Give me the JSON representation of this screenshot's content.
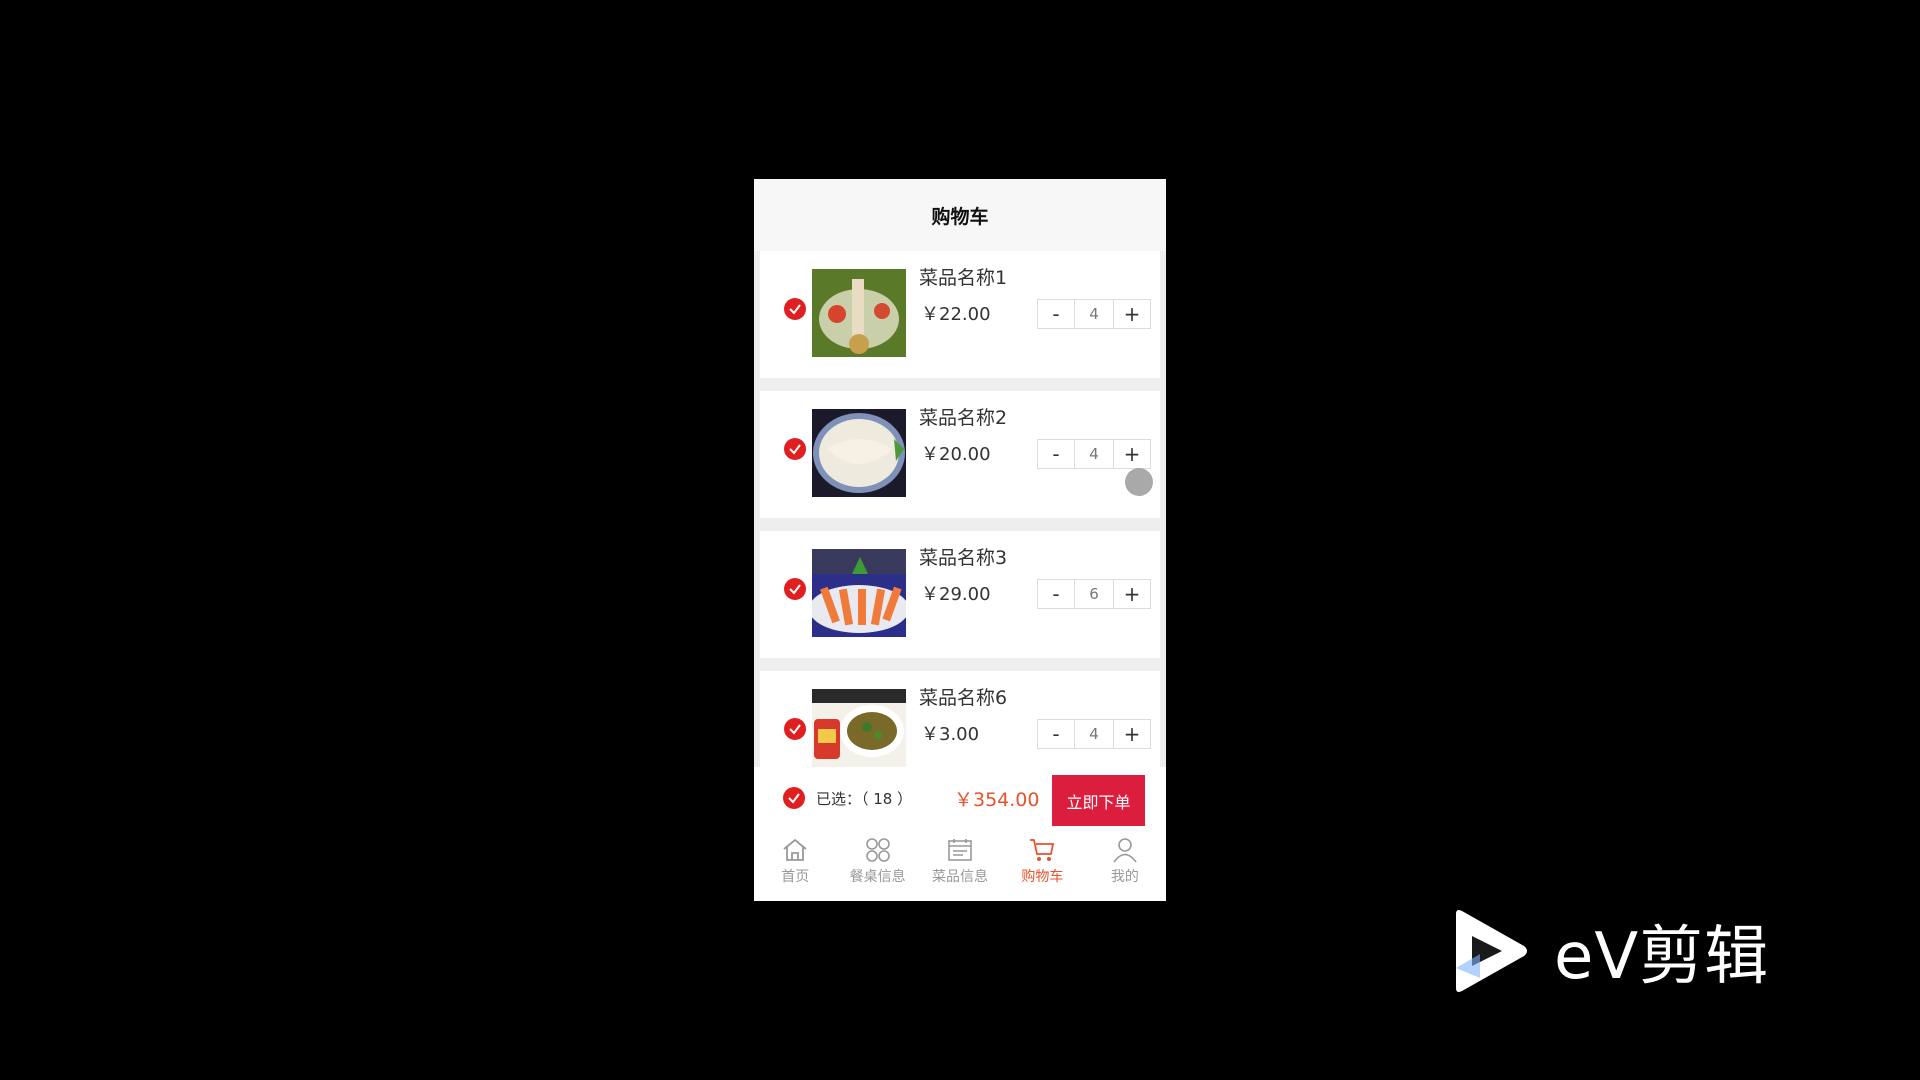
{
  "header": {
    "title": "购物车"
  },
  "cart_items": [
    {
      "name": "菜品名称1",
      "price": "￥22.00",
      "qty": "4",
      "selected": true
    },
    {
      "name": "菜品名称2",
      "price": "￥20.00",
      "qty": "4",
      "selected": true
    },
    {
      "name": "菜品名称3",
      "price": "￥29.00",
      "qty": "6",
      "selected": true
    },
    {
      "name": "菜品名称6",
      "price": "￥3.00",
      "qty": "4",
      "selected": true
    }
  ],
  "stepper": {
    "minus": "-",
    "plus": "+"
  },
  "footer": {
    "selected_label": "已选：（ 18 ）",
    "total": "￥354.00",
    "order_button": "立即下单"
  },
  "tabbar": [
    {
      "label": "首页",
      "icon": "home-icon"
    },
    {
      "label": "餐桌信息",
      "icon": "grid-icon"
    },
    {
      "label": "菜品信息",
      "icon": "menu-icon"
    },
    {
      "label": "购物车",
      "icon": "cart-icon",
      "active": true
    },
    {
      "label": "我的",
      "icon": "user-icon"
    }
  ],
  "watermark": {
    "text": "eV剪辑"
  },
  "colors": {
    "accent": "#e02020",
    "price_total": "#e8532b",
    "order_button": "#dc1e3e",
    "active_tab": "#e8532b"
  }
}
